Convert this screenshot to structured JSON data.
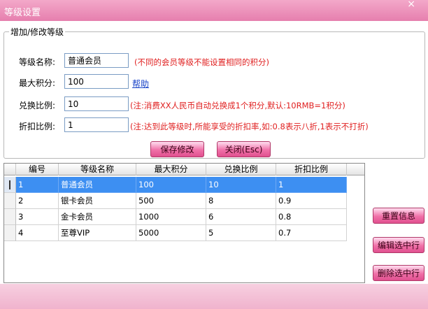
{
  "window": {
    "title": "等级设置",
    "close_glyph": "×"
  },
  "form": {
    "legend": "增加/修改等级",
    "name_label": "等级名称:",
    "name_value": "普通会员",
    "name_hint": "(不同的会员等级不能设置相同的积分)",
    "max_points_label": "最大积分:",
    "max_points_value": "100",
    "help_link": "帮助",
    "exchange_label": "兑换比例:",
    "exchange_value": "10",
    "exchange_hint": "(注:消费XX人民币自动兑换成1个积分,默认:10RMB=1积分)",
    "discount_label": "折扣比例:",
    "discount_value": "1",
    "discount_hint": "(注:达到此等级时,所能享受的折扣率,如:0.8表示八折,1表示不打折)",
    "save_button": "保存修改",
    "close_button": "关闭(Esc)"
  },
  "grid": {
    "columns": [
      "编号",
      "等级名称",
      "最大积分",
      "兑换比例",
      "折扣比例"
    ],
    "rows": [
      {
        "id": "1",
        "name": "普通会员",
        "max": "100",
        "ratio": "10",
        "discount": "1"
      },
      {
        "id": "2",
        "name": "银卡会员",
        "max": "500",
        "ratio": "8",
        "discount": "0.9"
      },
      {
        "id": "3",
        "name": "金卡会员",
        "max": "1000",
        "ratio": "6",
        "discount": "0.8"
      },
      {
        "id": "4",
        "name": "至尊VIP",
        "max": "5000",
        "ratio": "5",
        "discount": "0.7"
      }
    ],
    "selected_row": 0
  },
  "actions": {
    "reset": "重置信息",
    "edit": "编辑选中行",
    "delete": "删除选中行"
  },
  "colors": {
    "accent": "#e67fae",
    "selection": "#3d8ff2",
    "hint": "#e02020",
    "link": "#1a44c8"
  }
}
